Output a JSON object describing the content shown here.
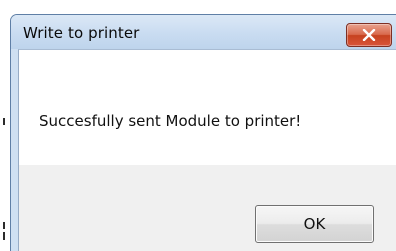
{
  "dialog": {
    "title": "Write to printer",
    "message": "Succesfully sent Module to printer!",
    "ok_label": "OK",
    "close_icon": "close-icon"
  },
  "colors": {
    "titlebar": "#c9dcf1",
    "close_button": "#d9553a",
    "client_background": "#f0f0f0",
    "message_background": "#ffffff"
  }
}
